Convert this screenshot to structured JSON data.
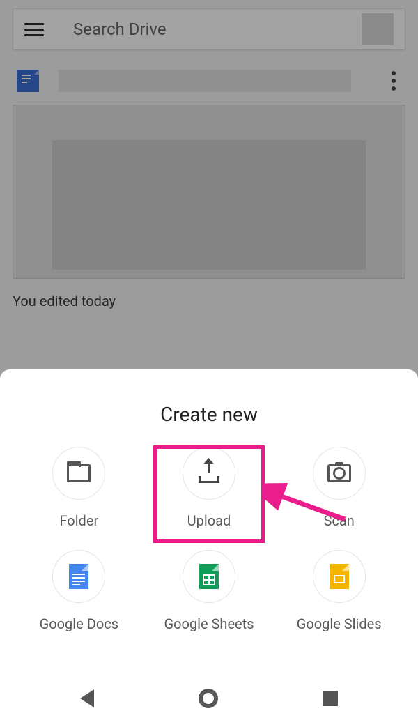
{
  "search": {
    "placeholder": "Search Drive"
  },
  "file": {
    "edited_text": "You edited today"
  },
  "sheet": {
    "title": "Create new",
    "items": [
      {
        "label": "Folder"
      },
      {
        "label": "Upload"
      },
      {
        "label": "Scan"
      },
      {
        "label": "Google Docs"
      },
      {
        "label": "Google Sheets"
      },
      {
        "label": "Google Slides"
      }
    ]
  },
  "annotation": {
    "highlight_color": "#e91e8c",
    "highlighted_item": "Upload"
  }
}
